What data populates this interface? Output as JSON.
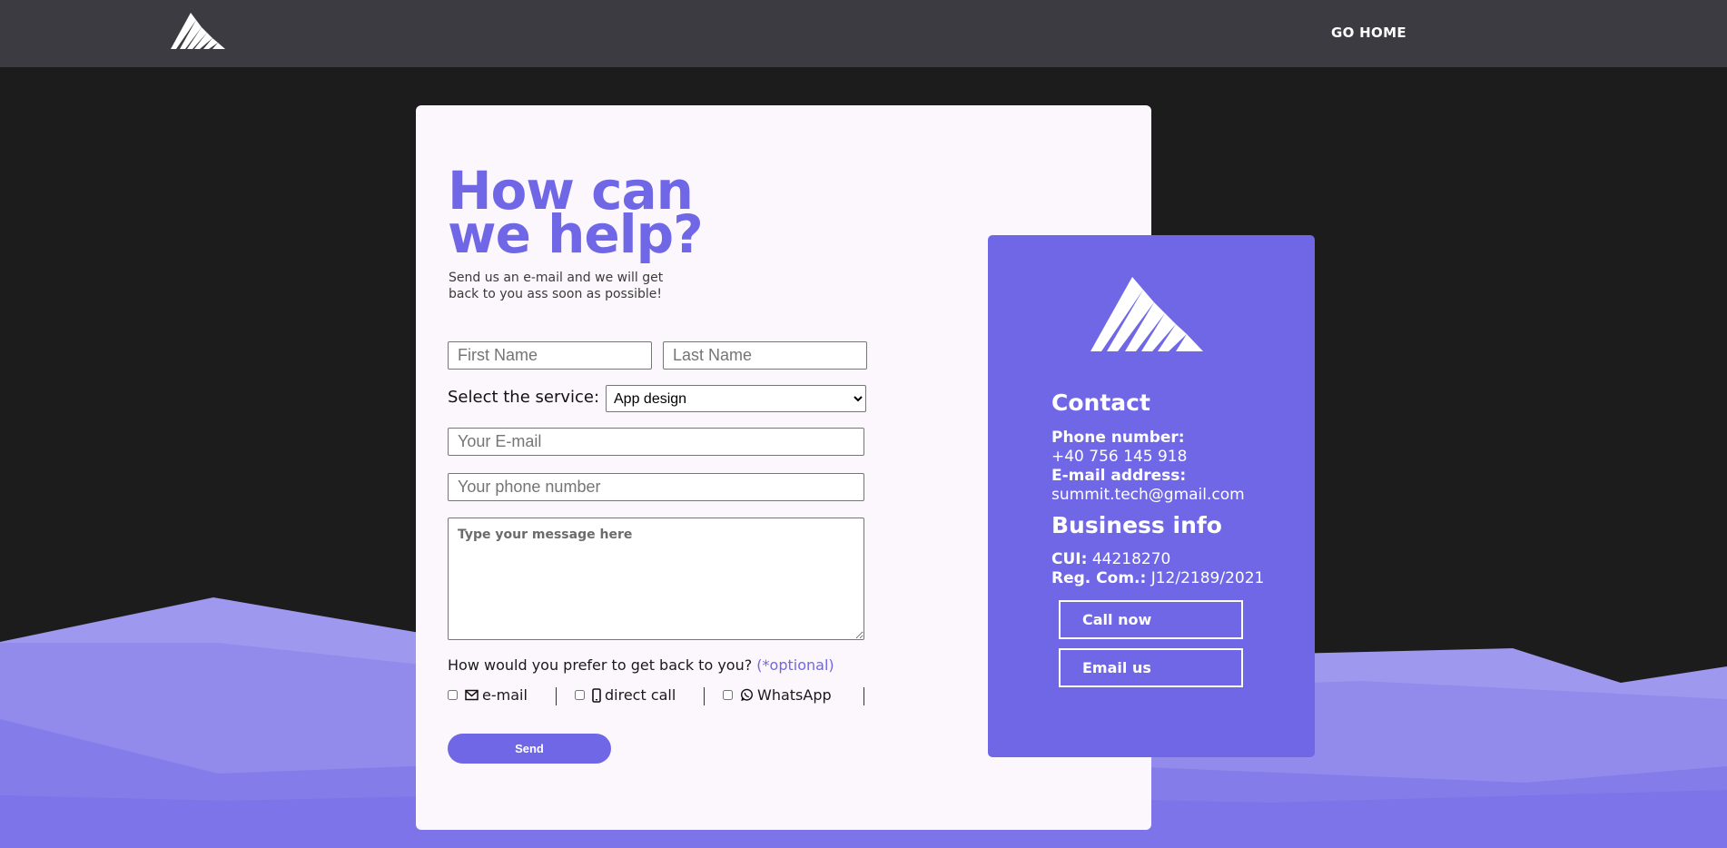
{
  "header": {
    "logo_icon": "mountain-logo-icon",
    "go_home_label": "GO HOME"
  },
  "form": {
    "heading_line1": "How can",
    "heading_line2": "we help?",
    "subtitle_line1": "Send us an e-mail and we will get",
    "subtitle_line2": "back to you ass soon as possible!",
    "first_name_placeholder": "First Name",
    "last_name_placeholder": "Last Name",
    "service_label": "Select the service:",
    "service_selected": "App design",
    "email_placeholder": "Your E-mail",
    "phone_placeholder": "Your phone number",
    "message_placeholder": "Type your message here",
    "prefer_label": "How would you prefer to get back to you?",
    "optional_label": "(*optional)",
    "option_email": "e-mail",
    "option_call": "direct call",
    "option_whatsapp": "WhatsApp",
    "send_label": "Send"
  },
  "contact": {
    "title": "Contact",
    "phone_key": "Phone number:",
    "phone_value": "+40 756 145 918",
    "email_key": "E-mail address:",
    "email_value": "summit.tech@gmail.com",
    "business_title": "Business info",
    "cui_key": "CUI:",
    "cui_value": "44218270",
    "reg_key": "Reg. Com.:",
    "reg_value": "J12/2189/2021",
    "call_now_label": "Call now",
    "email_us_label": "Email us"
  },
  "colors": {
    "accent": "#7067e6",
    "header_bg": "#3c3b41",
    "page_bg": "#1c1c1c",
    "card_bg": "#fcf7fc"
  }
}
